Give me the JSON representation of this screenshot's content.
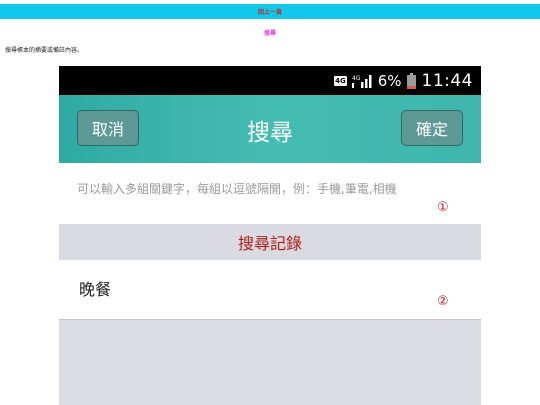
{
  "top_link": "回上一頁",
  "page_title": "搜尋",
  "description": "搜尋帳本的摘要或備註內容。",
  "status_bar": {
    "network_badge": "4G",
    "network_small": "4G",
    "battery_percent": "6%",
    "time": "11:44"
  },
  "header": {
    "cancel_label": "取消",
    "title": "搜尋",
    "confirm_label": "確定"
  },
  "search": {
    "placeholder": "可以輸入多組關鍵字，每組以逗號隔開，例：手機,筆電,相機",
    "value": "",
    "marker": "①"
  },
  "history": {
    "header": "搜尋記錄",
    "items": [
      {
        "label": "晚餐",
        "marker": "②"
      }
    ]
  },
  "colors": {
    "top_bar": "#12c8ea",
    "header_teal": "#45bcb2",
    "accent_red": "#b01c1c"
  }
}
